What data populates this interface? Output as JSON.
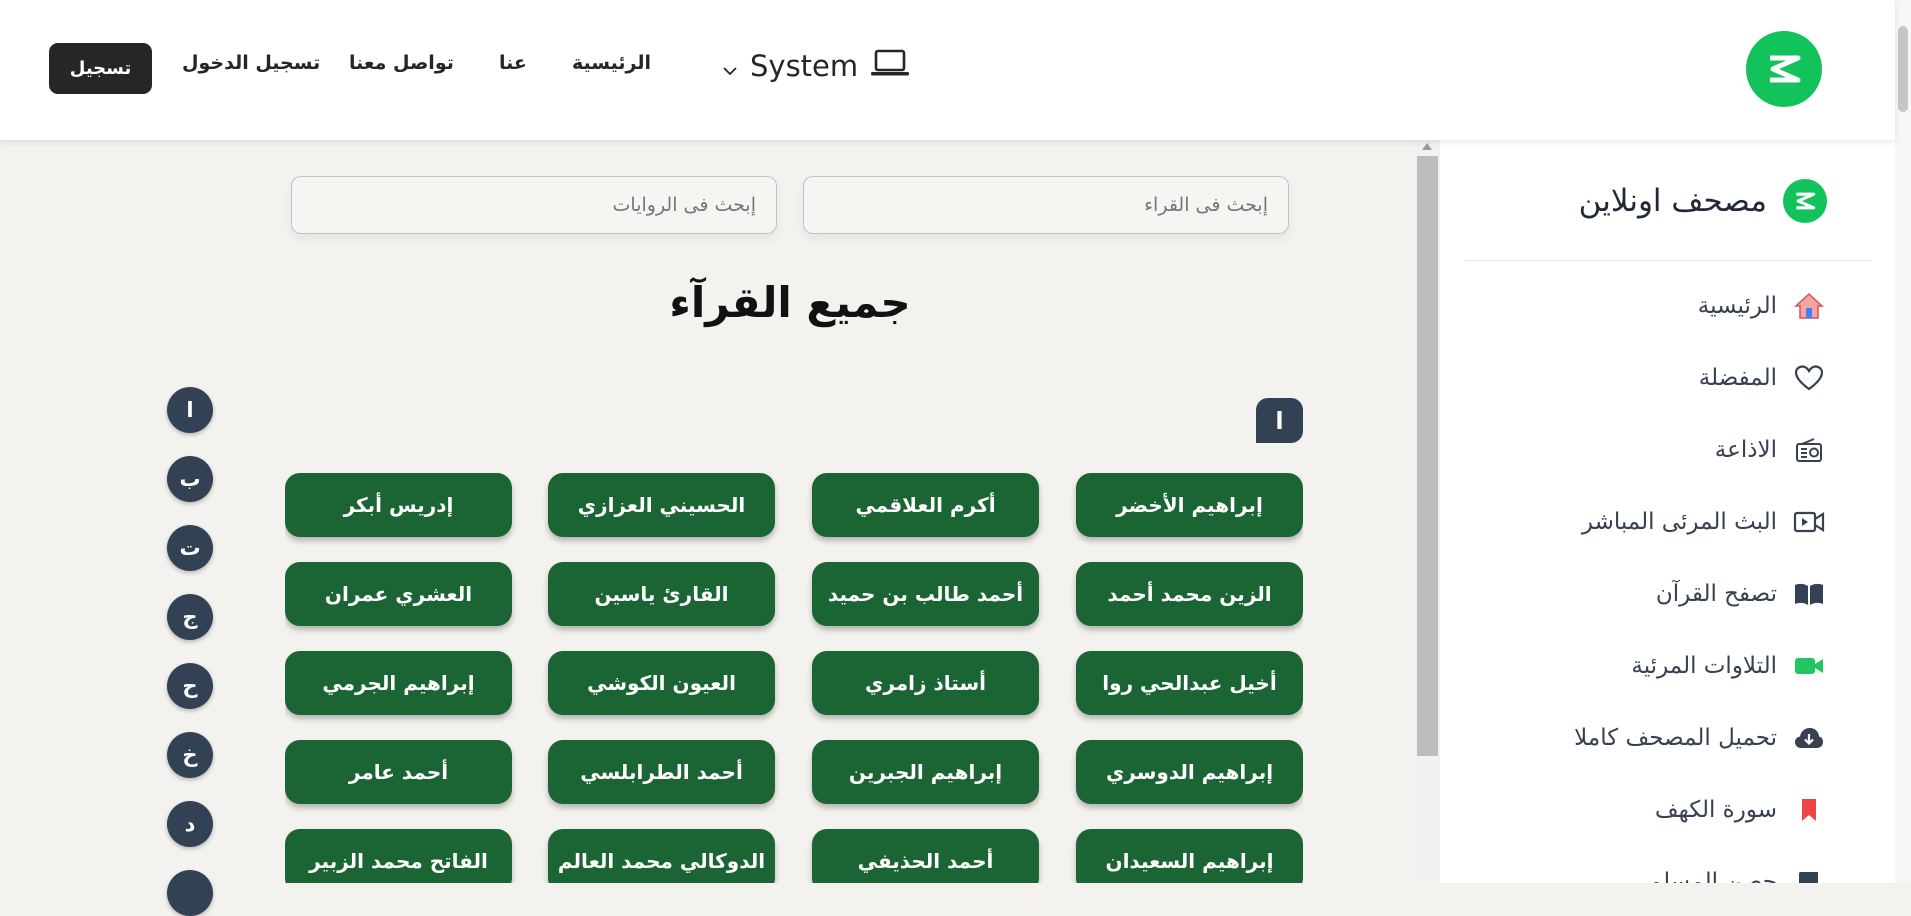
{
  "header": {
    "register_label": "تسجيل",
    "login_label": "تسجيل الدخول",
    "contact_label": "تواصل معنا",
    "about_label": "عنا",
    "home_label": "الرئيسية",
    "theme_selected": "System"
  },
  "search": {
    "readers_placeholder": "إبحث فى القراء",
    "narrations_placeholder": "إبحث فى الروايات"
  },
  "main": {
    "title": "جميع القرآء",
    "section_letter": "ا",
    "letters": [
      "ا",
      "ب",
      "ت",
      "ج",
      "ح",
      "خ",
      "د"
    ],
    "readers": [
      "إبراهيم الأخضر",
      "أكرم العلاقمي",
      "الحسيني العزازي",
      "إدريس أبكر",
      "الزين محمد أحمد",
      "أحمد طالب بن حميد",
      "القارئ ياسين",
      "العشري عمران",
      "أخيل عبدالحي روا",
      "أستاذ زامري",
      "العيون الكوشي",
      "إبراهيم الجرمي",
      "إبراهيم الدوسري",
      "إبراهيم الجبرين",
      "أحمد الطرابلسي",
      "أحمد عامر",
      "إبراهيم السعيدان",
      "أحمد الحذيفي",
      "الدوكالي محمد العالم",
      "الفاتح محمد الزبير"
    ]
  },
  "sidebar": {
    "brand": "مصحف اونلاين",
    "items": [
      {
        "label": "الرئيسية",
        "icon": "house-icon"
      },
      {
        "label": "المفضلة",
        "icon": "heart-icon"
      },
      {
        "label": "الاذاعة",
        "icon": "radio-icon"
      },
      {
        "label": "البث المرئى المباشر",
        "icon": "live-video-icon"
      },
      {
        "label": "تصفح القرآن",
        "icon": "open-book-icon"
      },
      {
        "label": "التلاوات المرئية",
        "icon": "video-camera-icon"
      },
      {
        "label": "تحميل المصحف كاملا",
        "icon": "cloud-download-icon"
      },
      {
        "label": "سورة الكهف",
        "icon": "bookmark-icon"
      },
      {
        "label": "حصن المسلم",
        "icon": "book-icon"
      }
    ]
  },
  "colors": {
    "brand_green": "#12c25b",
    "reader_button": "#1b6434",
    "letter_button": "#334155",
    "bookmark_red": "#ef4444",
    "video_green": "#22c55e"
  }
}
